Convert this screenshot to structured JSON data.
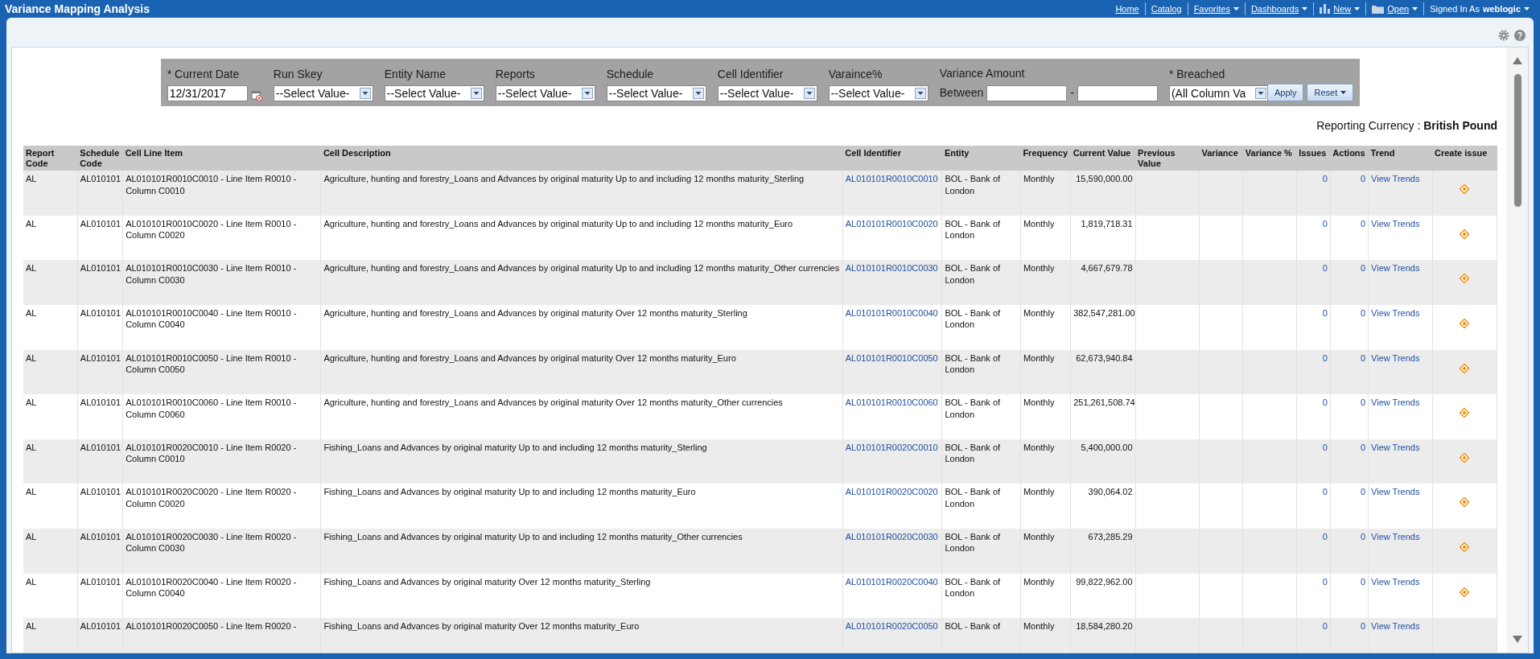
{
  "header": {
    "title": "Variance Mapping Analysis",
    "nav": [
      {
        "label": "Home",
        "menu": false,
        "kind": "plain"
      },
      {
        "label": "Catalog",
        "menu": false,
        "kind": "plain"
      },
      {
        "label": "Favorites",
        "menu": true,
        "kind": "plain"
      },
      {
        "label": "Dashboards",
        "menu": true,
        "kind": "plain"
      },
      {
        "label": "New",
        "menu": true,
        "kind": "chart"
      },
      {
        "label": "Open",
        "menu": true,
        "kind": "folder"
      }
    ],
    "signed_in_label": "Signed In As",
    "user": "weblogic"
  },
  "filters": [
    {
      "kind": "date",
      "label": "* Current Date",
      "value": "12/31/2017"
    },
    {
      "kind": "select",
      "label": "Run Skey",
      "value": "--Select Value-"
    },
    {
      "kind": "select",
      "label": "Entity Name",
      "value": "--Select Value-"
    },
    {
      "kind": "select",
      "label": "Reports",
      "value": "--Select Value-"
    },
    {
      "kind": "select",
      "label": "Schedule",
      "value": "--Select Value-"
    },
    {
      "kind": "select",
      "label": "Cell Identifier",
      "value": "--Select Value-"
    },
    {
      "kind": "select",
      "label": "Varaince%",
      "value": "--Select Value-"
    },
    {
      "kind": "range",
      "label": "Variance Amount",
      "prefix": "Between",
      "separator": "-"
    },
    {
      "kind": "select",
      "label": "* Breached",
      "value": "(All Column Va"
    }
  ],
  "filter_buttons": [
    {
      "label": "Apply",
      "menu": false
    },
    {
      "label": "Reset",
      "menu": true
    }
  ],
  "currency": {
    "label": "Reporting Currency :",
    "value": "British Pound"
  },
  "table": {
    "columns": [
      "Report Code",
      "Schedule Code",
      "Cell Line Item",
      "Cell Description",
      "Cell Identifier",
      "Entity",
      "Frequency",
      "Current Value",
      "Previous Value",
      "Variance",
      "Variance %",
      "Issues",
      "Actions",
      "Trend",
      "Create issue"
    ],
    "rows": [
      {
        "report_code": "AL",
        "schedule_code": "AL010101",
        "line_item": "AL010101R0010C0010 - Line Item R0010 - Column C0010",
        "description": "Agriculture, hunting and forestry_Loans and Advances by original maturity Up to and including 12 months maturity_Sterling",
        "identifier": "AL010101R0010C0010",
        "entity": "BOL - Bank of London",
        "frequency": "Monthly",
        "current_value": "15,590,000.00",
        "issues": "0",
        "actions": "0",
        "trend": "View Trends",
        "create_issue": true
      },
      {
        "report_code": "AL",
        "schedule_code": "AL010101",
        "line_item": "AL010101R0010C0020 - Line Item R0010 - Column C0020",
        "description": "Agriculture, hunting and forestry_Loans and Advances by original maturity Up to and including 12 months maturity_Euro",
        "identifier": "AL010101R0010C0020",
        "entity": "BOL - Bank of London",
        "frequency": "Monthly",
        "current_value": "1,819,718.31",
        "issues": "0",
        "actions": "0",
        "trend": "View Trends",
        "create_issue": true
      },
      {
        "report_code": "AL",
        "schedule_code": "AL010101",
        "line_item": "AL010101R0010C0030 - Line Item R0010 - Column C0030",
        "description": "Agriculture, hunting and forestry_Loans and Advances by original maturity Up to and including 12 months maturity_Other currencies",
        "identifier": "AL010101R0010C0030",
        "entity": "BOL - Bank of London",
        "frequency": "Monthly",
        "current_value": "4,667,679.78",
        "issues": "0",
        "actions": "0",
        "trend": "View Trends",
        "create_issue": true
      },
      {
        "report_code": "AL",
        "schedule_code": "AL010101",
        "line_item": "AL010101R0010C0040 - Line Item R0010 - Column C0040",
        "description": "Agriculture, hunting and forestry_Loans and Advances by original maturity Over 12 months maturity_Sterling",
        "identifier": "AL010101R0010C0040",
        "entity": "BOL - Bank of London",
        "frequency": "Monthly",
        "current_value": "382,547,281.00",
        "issues": "0",
        "actions": "0",
        "trend": "View Trends",
        "create_issue": true
      },
      {
        "report_code": "AL",
        "schedule_code": "AL010101",
        "line_item": "AL010101R0010C0050 - Line Item R0010 - Column C0050",
        "description": "Agriculture, hunting and forestry_Loans and Advances by original maturity Over 12 months maturity_Euro",
        "identifier": "AL010101R0010C0050",
        "entity": "BOL - Bank of London",
        "frequency": "Monthly",
        "current_value": "62,673,940.84",
        "issues": "0",
        "actions": "0",
        "trend": "View Trends",
        "create_issue": true
      },
      {
        "report_code": "AL",
        "schedule_code": "AL010101",
        "line_item": "AL010101R0010C0060 - Line Item R0010 - Column C0060",
        "description": "Agriculture, hunting and forestry_Loans and Advances by original maturity Over 12 months maturity_Other currencies",
        "identifier": "AL010101R0010C0060",
        "entity": "BOL - Bank of London",
        "frequency": "Monthly",
        "current_value": "251,261,508.74",
        "issues": "0",
        "actions": "0",
        "trend": "View Trends",
        "create_issue": true
      },
      {
        "report_code": "AL",
        "schedule_code": "AL010101",
        "line_item": "AL010101R0020C0010 - Line Item R0020 - Column C0010",
        "description": "Fishing_Loans and Advances by original maturity Up to and including 12 months maturity_Sterling",
        "identifier": "AL010101R0020C0010",
        "entity": "BOL - Bank of London",
        "frequency": "Monthly",
        "current_value": "5,400,000.00",
        "issues": "0",
        "actions": "0",
        "trend": "View Trends",
        "create_issue": true
      },
      {
        "report_code": "AL",
        "schedule_code": "AL010101",
        "line_item": "AL010101R0020C0020 - Line Item R0020 - Column C0020",
        "description": "Fishing_Loans and Advances by original maturity Up to and including 12 months maturity_Euro",
        "identifier": "AL010101R0020C0020",
        "entity": "BOL - Bank of London",
        "frequency": "Monthly",
        "current_value": "390,064.02",
        "issues": "0",
        "actions": "0",
        "trend": "View Trends",
        "create_issue": true
      },
      {
        "report_code": "AL",
        "schedule_code": "AL010101",
        "line_item": "AL010101R0020C0030 - Line Item R0020 - Column C0030",
        "description": "Fishing_Loans and Advances by original maturity Up to and including 12 months maturity_Other currencies",
        "identifier": "AL010101R0020C0030",
        "entity": "BOL - Bank of London",
        "frequency": "Monthly",
        "current_value": "673,285.29",
        "issues": "0",
        "actions": "0",
        "trend": "View Trends",
        "create_issue": true
      },
      {
        "report_code": "AL",
        "schedule_code": "AL010101",
        "line_item": "AL010101R0020C0040 - Line Item R0020 - Column C0040",
        "description": "Fishing_Loans and Advances by original maturity Over 12 months maturity_Sterling",
        "identifier": "AL010101R0020C0040",
        "entity": "BOL - Bank of London",
        "frequency": "Monthly",
        "current_value": "99,822,962.00",
        "issues": "0",
        "actions": "0",
        "trend": "View Trends",
        "create_issue": true
      },
      {
        "report_code": "AL",
        "schedule_code": "AL010101",
        "line_item": "AL010101R0020C0050 - Line Item R0020 -",
        "description": "Fishing_Loans and Advances by original maturity Over 12 months maturity_Euro",
        "identifier": "AL010101R0020C0050",
        "entity": "BOL - Bank of",
        "frequency": "Monthly",
        "current_value": "18,584,280.20",
        "issues": "0",
        "actions": "0",
        "trend": "View Trends",
        "create_issue": false
      }
    ]
  }
}
